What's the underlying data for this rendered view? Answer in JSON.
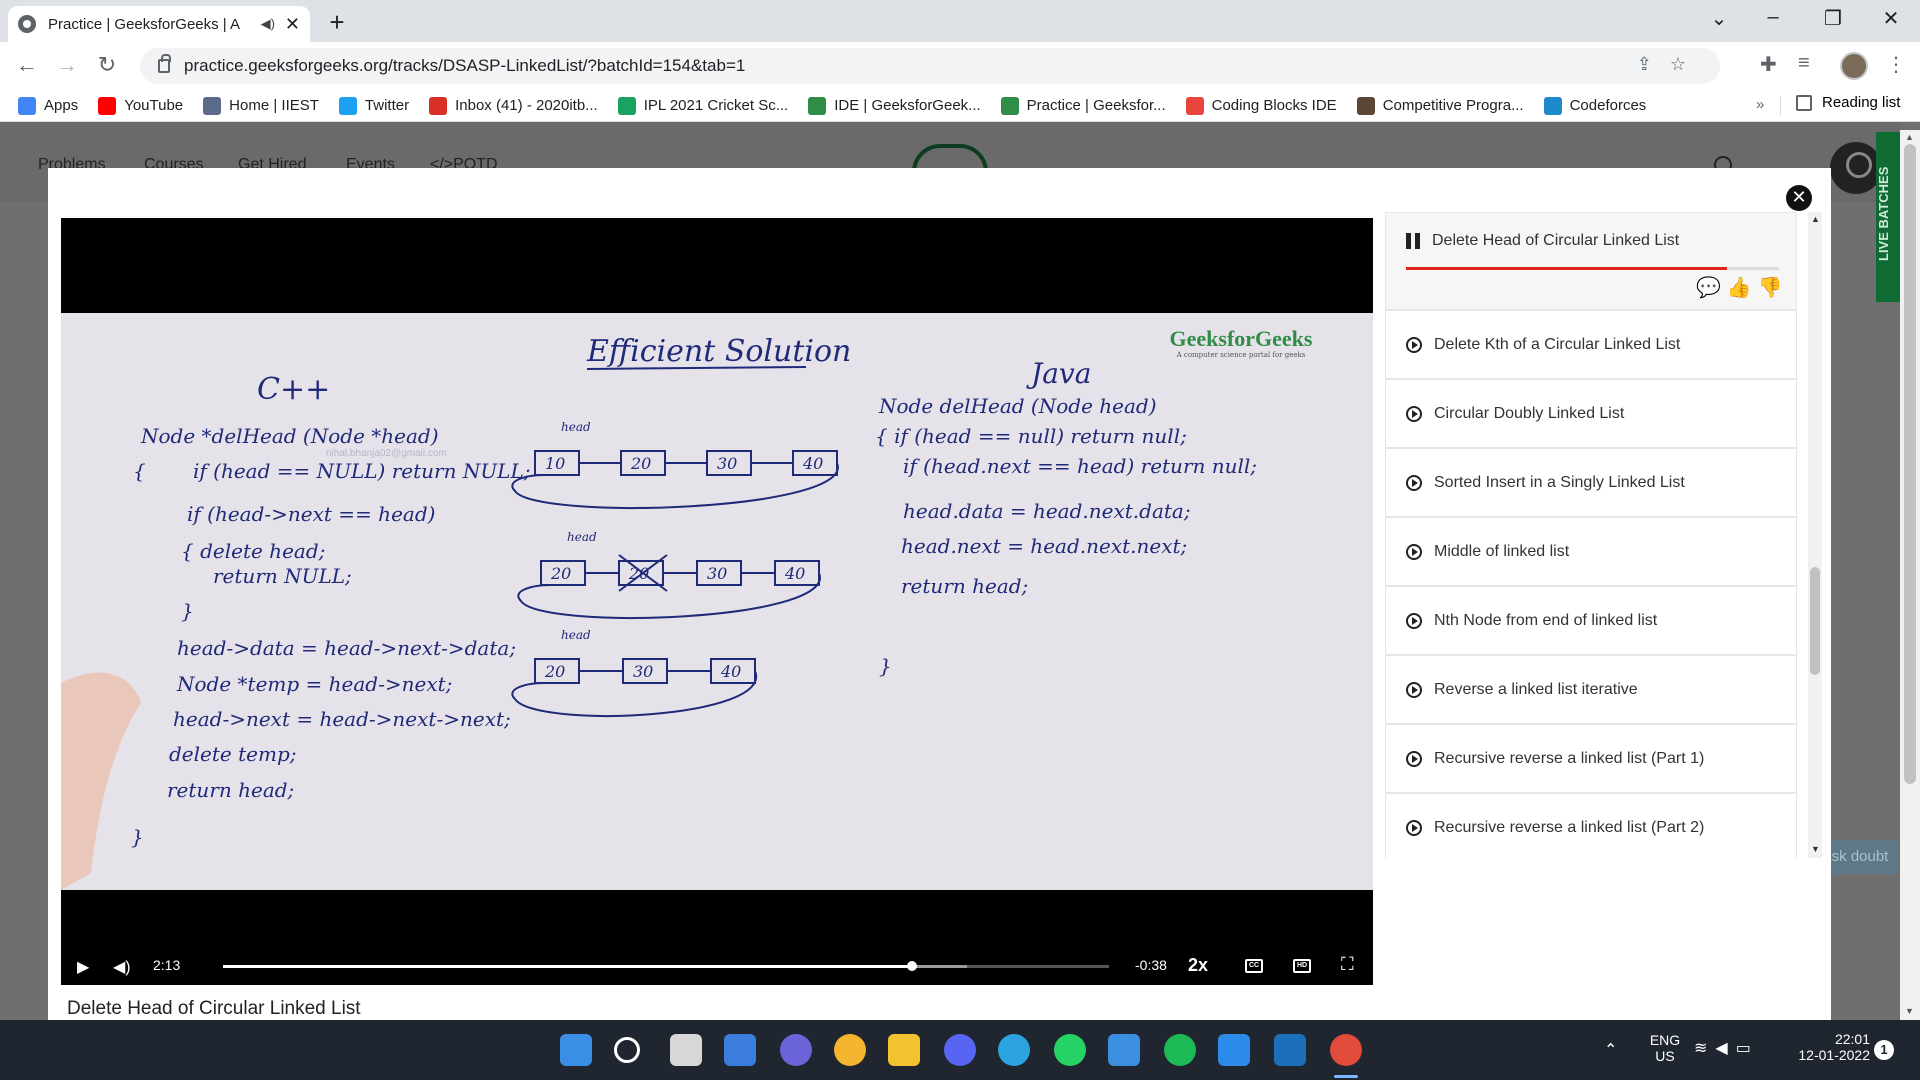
{
  "browser": {
    "tab_title": "Practice | GeeksforGeeks | A",
    "url": "practice.geeksforgeeks.org/tracks/DSASP-LinkedList/?batchId=154&tab=1",
    "bookmarks": [
      {
        "label": "Apps",
        "icon": "apps-grid-icon",
        "color": "#4285f4"
      },
      {
        "label": "YouTube",
        "icon": "youtube-icon",
        "color": "#ff0000"
      },
      {
        "label": "Home | IIEST",
        "icon": "iiest-icon",
        "color": "#5b6b8c"
      },
      {
        "label": "Twitter",
        "icon": "twitter-icon",
        "color": "#1da1f2"
      },
      {
        "label": "Inbox (41) - 2020itb...",
        "icon": "gmail-icon",
        "color": "#d93025"
      },
      {
        "label": "IPL 2021 Cricket Sc...",
        "icon": "cricbuzz-icon",
        "color": "#1aa260"
      },
      {
        "label": "IDE | GeeksforGeek...",
        "icon": "gfg-icon",
        "color": "#2f8d46"
      },
      {
        "label": "Practice | Geeksfor...",
        "icon": "gfg-icon",
        "color": "#2f8d46"
      },
      {
        "label": "Coding Blocks IDE",
        "icon": "coding-blocks-icon",
        "color": "#e8453c"
      },
      {
        "label": "Competitive Progra...",
        "icon": "cc-icon",
        "color": "#5b4638"
      },
      {
        "label": "Codeforces",
        "icon": "codeforces-icon",
        "color": "#1f8acb"
      }
    ],
    "more_label": "»",
    "reading_list": "Reading list"
  },
  "page": {
    "nav": [
      "Problems",
      "Courses",
      "Get Hired",
      "Events",
      "</>POTD"
    ],
    "live_batches": "LIVE BATCHES",
    "ask_doubt": "Ask doubt"
  },
  "player": {
    "time_elapsed": "2:13",
    "time_remaining": "-0:38",
    "speed": "2x",
    "progress": 0.778,
    "buffered": 0.84,
    "cc_label": "CC",
    "hd_label": "HD"
  },
  "whiteboard": {
    "heading": "Efficient Solution",
    "cpp_label": "C++",
    "java_label": "Java",
    "brand": "GeeksforGeeks",
    "brand_tagline": "A computer science portal for geeks",
    "watermark": "nihal.bhanja02@gmail.com",
    "cpp_code": [
      "Node *delHead (Node *head)",
      "{",
      "if (head == NULL) return NULL;",
      "if (head->next == head)",
      "{ delete head;",
      "return NULL;",
      "}",
      "head->data = head->next->data;",
      "Node *temp = head->next;",
      "head->next = head->next->next;",
      "delete temp;",
      "return head;",
      "}"
    ],
    "java_code": [
      "Node delHead (Node head)",
      "{ if (head == null) return null;",
      "if (head.next == head) return null;",
      "head.data = head.next.data;",
      "head.next = head.next.next;",
      "return head;",
      "}"
    ],
    "list1": [
      "10",
      "20",
      "30",
      "40"
    ],
    "list2": [
      "20",
      "20",
      "30",
      "40"
    ],
    "list3": [
      "20",
      "30",
      "40"
    ],
    "head_label": "head"
  },
  "video_title": "Delete Head of Circular Linked List",
  "playlist": {
    "active": "Delete Head of Circular Linked List",
    "active_progress": 0.86,
    "items": [
      "Delete Kth of a Circular Linked List",
      "Circular Doubly Linked List",
      "Sorted Insert in a Singly Linked List",
      "Middle of linked list",
      "Nth Node from end of linked list",
      "Reverse a linked list iterative",
      "Recursive reverse a linked list (Part 1)",
      "Recursive reverse a linked list (Part 2)"
    ]
  },
  "taskbar": {
    "language": "ENG",
    "region": "US",
    "time": "22:01",
    "date": "12-01-2022",
    "notifications": "1"
  }
}
